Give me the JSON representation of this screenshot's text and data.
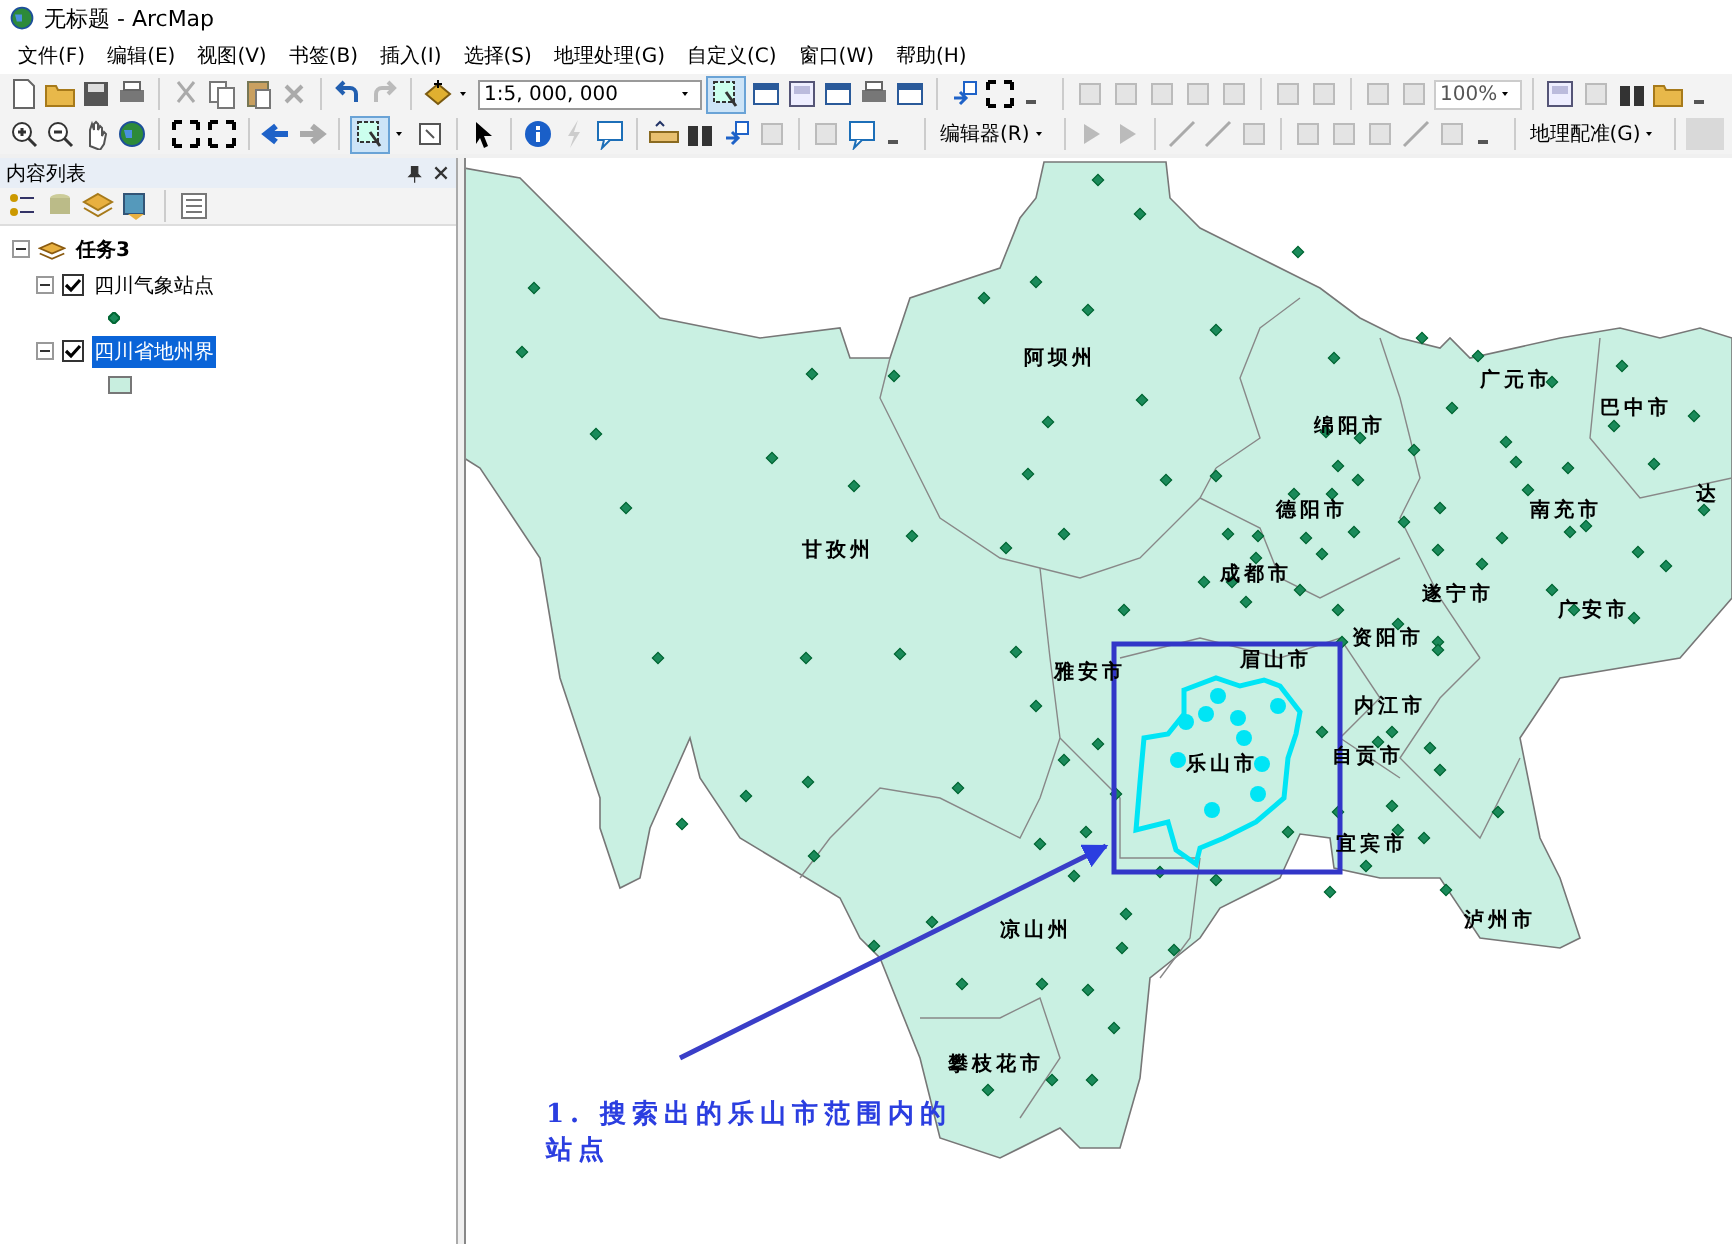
{
  "window": {
    "title": "无标题 - ArcMap"
  },
  "menu": [
    "文件(F)",
    "编辑(E)",
    "视图(V)",
    "书签(B)",
    "插入(I)",
    "选择(S)",
    "地理处理(G)",
    "自定义(C)",
    "窗口(W)",
    "帮助(H)"
  ],
  "toolbar": {
    "scale": "1:5, 000, 000",
    "zoom_percent": "100%",
    "editor_menu": "编辑器(R)",
    "georeferencing_menu": "地理配准(G)"
  },
  "toc": {
    "title": "内容列表",
    "root": {
      "label": "任务3",
      "expanded": true,
      "children": [
        {
          "label": "四川气象站点",
          "checked": true,
          "expanded": true,
          "selected": false,
          "kind": "point"
        },
        {
          "label": "四川省地州界",
          "checked": true,
          "expanded": true,
          "selected": true,
          "kind": "polygon"
        }
      ]
    }
  },
  "map": {
    "labels": [
      "阿坝州",
      "广元市",
      "巴中市",
      "绵阳市",
      "达",
      "德阳市",
      "南充市",
      "甘孜州",
      "成都市",
      "遂宁市",
      "广安市",
      "资阳市",
      "眉山市",
      "雅安市",
      "内江市",
      "乐山市",
      "自贡市",
      "宜宾市",
      "泸州市",
      "凉山州",
      "攀枝花市"
    ],
    "annotation": "1. 搜索出的乐山市范围内的站点"
  }
}
